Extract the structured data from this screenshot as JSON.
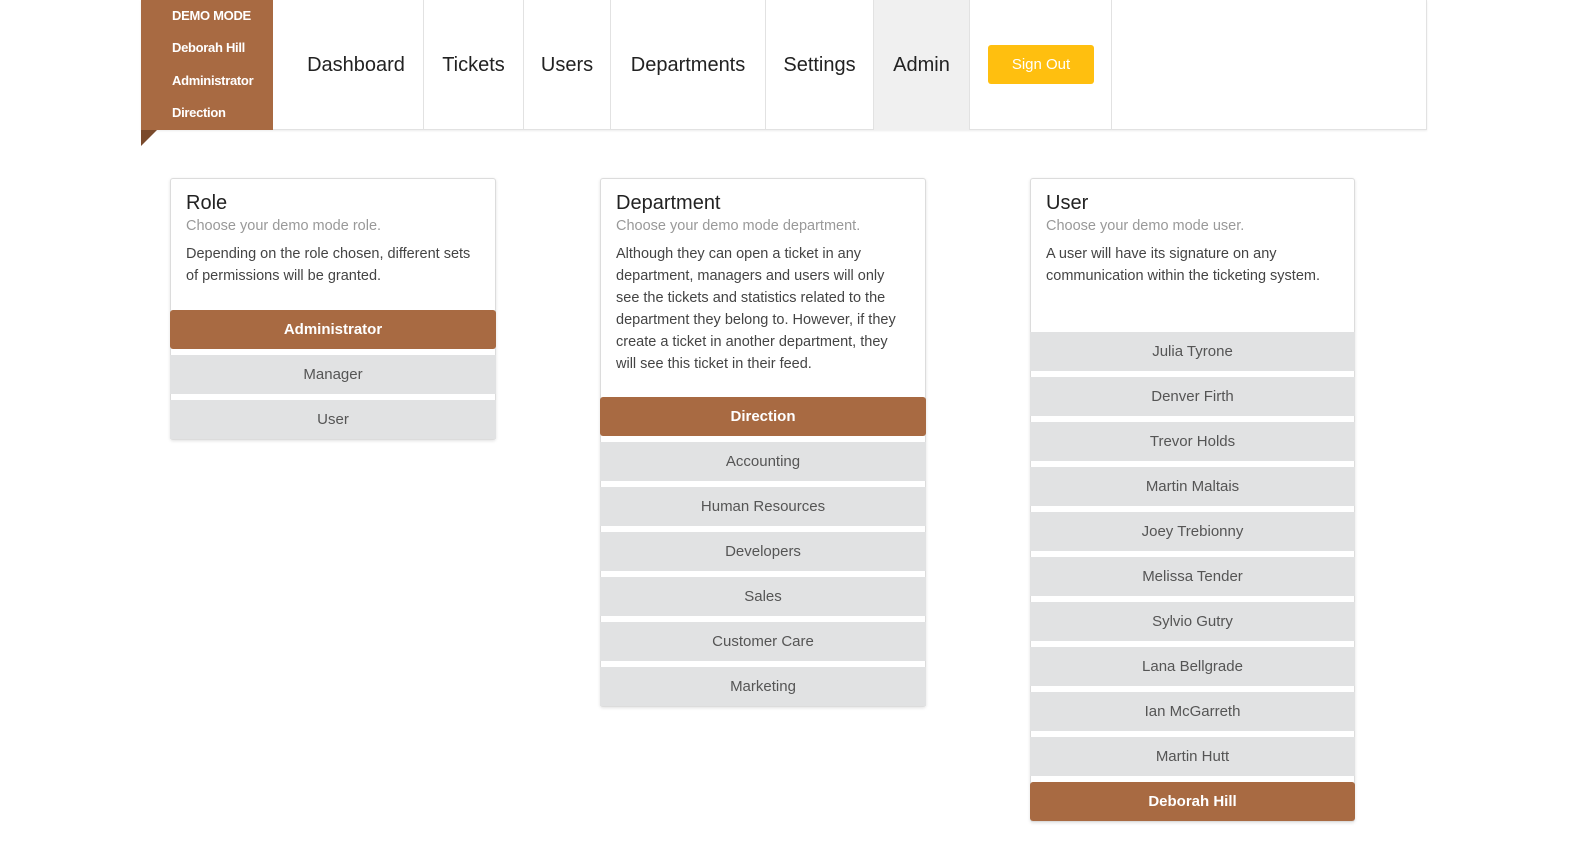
{
  "demo": {
    "mode": "DEMO MODE",
    "user": "Deborah Hill",
    "role": "Administrator",
    "department": "Direction"
  },
  "nav": {
    "items": [
      {
        "label": "Dashboard"
      },
      {
        "label": "Tickets"
      },
      {
        "label": "Users"
      },
      {
        "label": "Departments"
      },
      {
        "label": "Settings"
      },
      {
        "label": "Admin",
        "active": true
      }
    ],
    "sign_out": "Sign Out"
  },
  "role_card": {
    "title": "Role",
    "subtitle": "Choose your demo mode role.",
    "description": "Depending on the role chosen, different sets of permissions will be granted.",
    "options": [
      "Administrator",
      "Manager",
      "User"
    ],
    "selected": "Administrator"
  },
  "department_card": {
    "title": "Department",
    "subtitle": "Choose your demo mode department.",
    "description": "Although they can open a ticket in any department, managers and users will only see the tickets and statistics related to the department they belong to. However, if they create a ticket in another department, they will see this ticket in their feed.",
    "options": [
      "Direction",
      "Accounting",
      "Human Resources",
      "Developers",
      "Sales",
      "Customer Care",
      "Marketing"
    ],
    "selected": "Direction"
  },
  "user_card": {
    "title": "User",
    "subtitle": "Choose your demo mode user.",
    "description": "A user will have its signature on any communication within the ticketing system.",
    "options": [
      "Julia Tyrone",
      "Denver Firth",
      "Trevor Holds",
      "Martin Maltais",
      "Joey Trebionny",
      "Melissa Tender",
      "Sylvio Gutry",
      "Lana Bellgrade",
      "Ian McGarreth",
      "Martin Hutt",
      "Deborah Hill"
    ],
    "selected": "Deborah Hill"
  },
  "colors": {
    "accent": "#a86a42",
    "signout": "#ffbf0f",
    "option_bg": "#e1e2e3"
  }
}
